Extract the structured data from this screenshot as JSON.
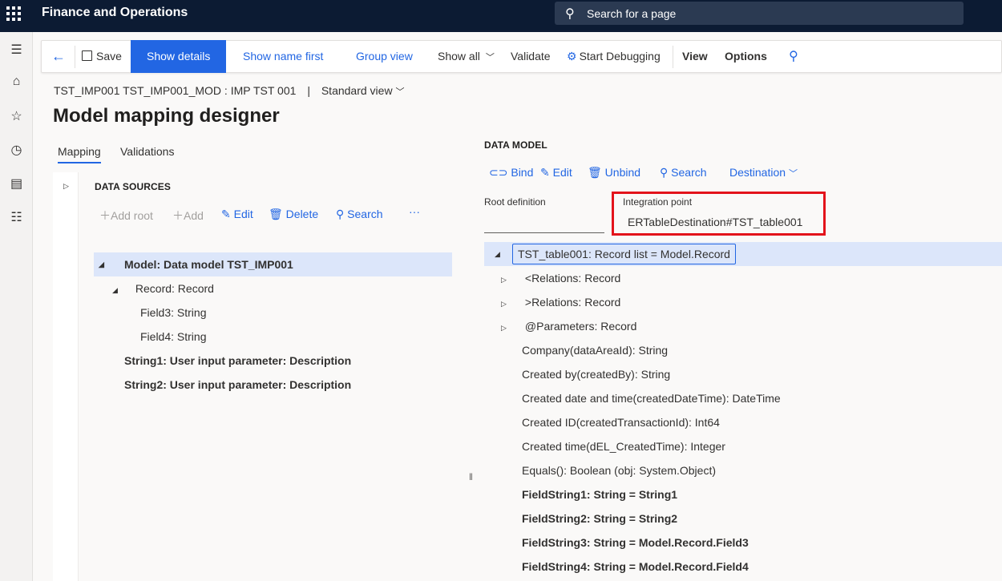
{
  "app": {
    "title": "Finance and Operations",
    "search_placeholder": "Search for a page"
  },
  "action_pane": {
    "save": "Save",
    "show_details": "Show details",
    "show_name_first": "Show name first",
    "group_view": "Group view",
    "show_all": "Show all",
    "validate": "Validate",
    "start_debugging": "Start Debugging",
    "view": "View",
    "options": "Options"
  },
  "header": {
    "breadcrumb": "TST_IMP001 TST_IMP001_MOD : IMP TST 001",
    "view_name": "Standard view",
    "title": "Model mapping designer"
  },
  "tabs": [
    {
      "label": "Mapping",
      "active": true
    },
    {
      "label": "Validations",
      "active": false
    }
  ],
  "data_sources": {
    "title": "DATA SOURCES",
    "toolbar": {
      "add_root": "Add root",
      "add": "Add",
      "edit": "Edit",
      "delete": "Delete",
      "search": "Search",
      "more": "···"
    },
    "tree": [
      {
        "label": "Model: Data model TST_IMP001",
        "bold": true,
        "selected": true,
        "expanded": true
      },
      {
        "label": "Record: Record",
        "bold": false,
        "expanded": true
      },
      {
        "label": "Field3: String",
        "bold": false
      },
      {
        "label": "Field4: String",
        "bold": false
      },
      {
        "label": "String1: User input parameter: Description",
        "bold": true
      },
      {
        "label": "String2: User input parameter: Description",
        "bold": true
      }
    ]
  },
  "data_model": {
    "title": "DATA MODEL",
    "toolbar": {
      "bind": "Bind",
      "edit": "Edit",
      "unbind": "Unbind",
      "search": "Search",
      "destination": "Destination"
    },
    "root_definition_label": "Root definition",
    "integration_point_label": "Integration point",
    "integration_point_value": "ERTableDestination#TST_table001",
    "tree": [
      {
        "label": "TST_table001: Record list = Model.Record",
        "selected": true
      },
      {
        "label": "<Relations: Record",
        "expandable": true
      },
      {
        "label": ">Relations: Record",
        "expandable": true
      },
      {
        "label": "@Parameters: Record",
        "expandable": true
      },
      {
        "label": "Company(dataAreaId): String"
      },
      {
        "label": "Created by(createdBy): String"
      },
      {
        "label": "Created date and time(createdDateTime): DateTime"
      },
      {
        "label": "Created ID(createdTransactionId): Int64"
      },
      {
        "label": "Created time(dEL_CreatedTime): Integer"
      },
      {
        "label": "Equals(): Boolean (obj: System.Object)"
      },
      {
        "label": "FieldString1: String = String1",
        "bold": true
      },
      {
        "label": "FieldString2: String = String2",
        "bold": true
      },
      {
        "label": "FieldString3: String = Model.Record.Field3",
        "bold": true
      },
      {
        "label": "FieldString4: String = Model.Record.Field4",
        "bold": true
      }
    ]
  },
  "colors": {
    "nav_bar": "#0c1b33",
    "accent": "#2266e3",
    "highlight_box": "#e3131b",
    "selected_row": "#dce6fa"
  }
}
